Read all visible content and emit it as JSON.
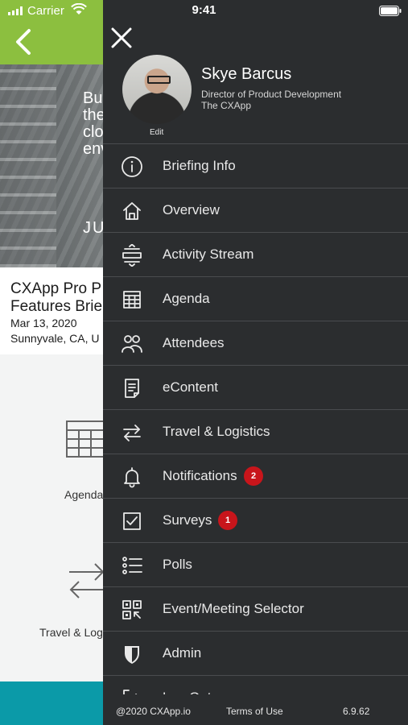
{
  "status_bar": {
    "carrier": "Carrier",
    "time": "9:41"
  },
  "event": {
    "hero_text": "Bu\nthe\nclo\nenv",
    "hero_date": "JU",
    "title": "CXApp Pro P\nFeatures Brie",
    "date": "Mar 13, 2020",
    "location": "Sunnyvale, CA, U"
  },
  "tiles": {
    "agenda": "Agenda",
    "travel": "Travel & Log"
  },
  "profile": {
    "name": "Skye Barcus",
    "title": "Director of Product Development",
    "company": "The CXApp",
    "edit_label": "Edit"
  },
  "menu": [
    {
      "label": "Briefing Info",
      "icon": "info-icon"
    },
    {
      "label": "Overview",
      "icon": "home-icon"
    },
    {
      "label": "Activity Stream",
      "icon": "activity-stream-icon"
    },
    {
      "label": "Agenda",
      "icon": "agenda-grid-icon"
    },
    {
      "label": "Attendees",
      "icon": "attendees-icon"
    },
    {
      "label": "eContent",
      "icon": "document-icon"
    },
    {
      "label": "Travel & Logistics",
      "icon": "swap-arrows-icon"
    },
    {
      "label": "Notifications",
      "icon": "bell-icon",
      "badge": "2"
    },
    {
      "label": "Surveys",
      "icon": "checkbox-icon",
      "badge": "1"
    },
    {
      "label": "Polls",
      "icon": "list-icon"
    },
    {
      "label": "Event/Meeting Selector",
      "icon": "qr-code-icon"
    },
    {
      "label": "Admin",
      "icon": "shield-icon"
    },
    {
      "label": "Log Out",
      "icon": "logout-icon"
    }
  ],
  "footer": {
    "copyright": "@2020 CXApp.io",
    "terms": "Terms of Use",
    "version": "6.9.62"
  },
  "colors": {
    "nav_green": "#8cbf3f",
    "drawer_bg": "#2b2d2f",
    "badge_red": "#c8151b",
    "teal": "#0b9aa8"
  }
}
